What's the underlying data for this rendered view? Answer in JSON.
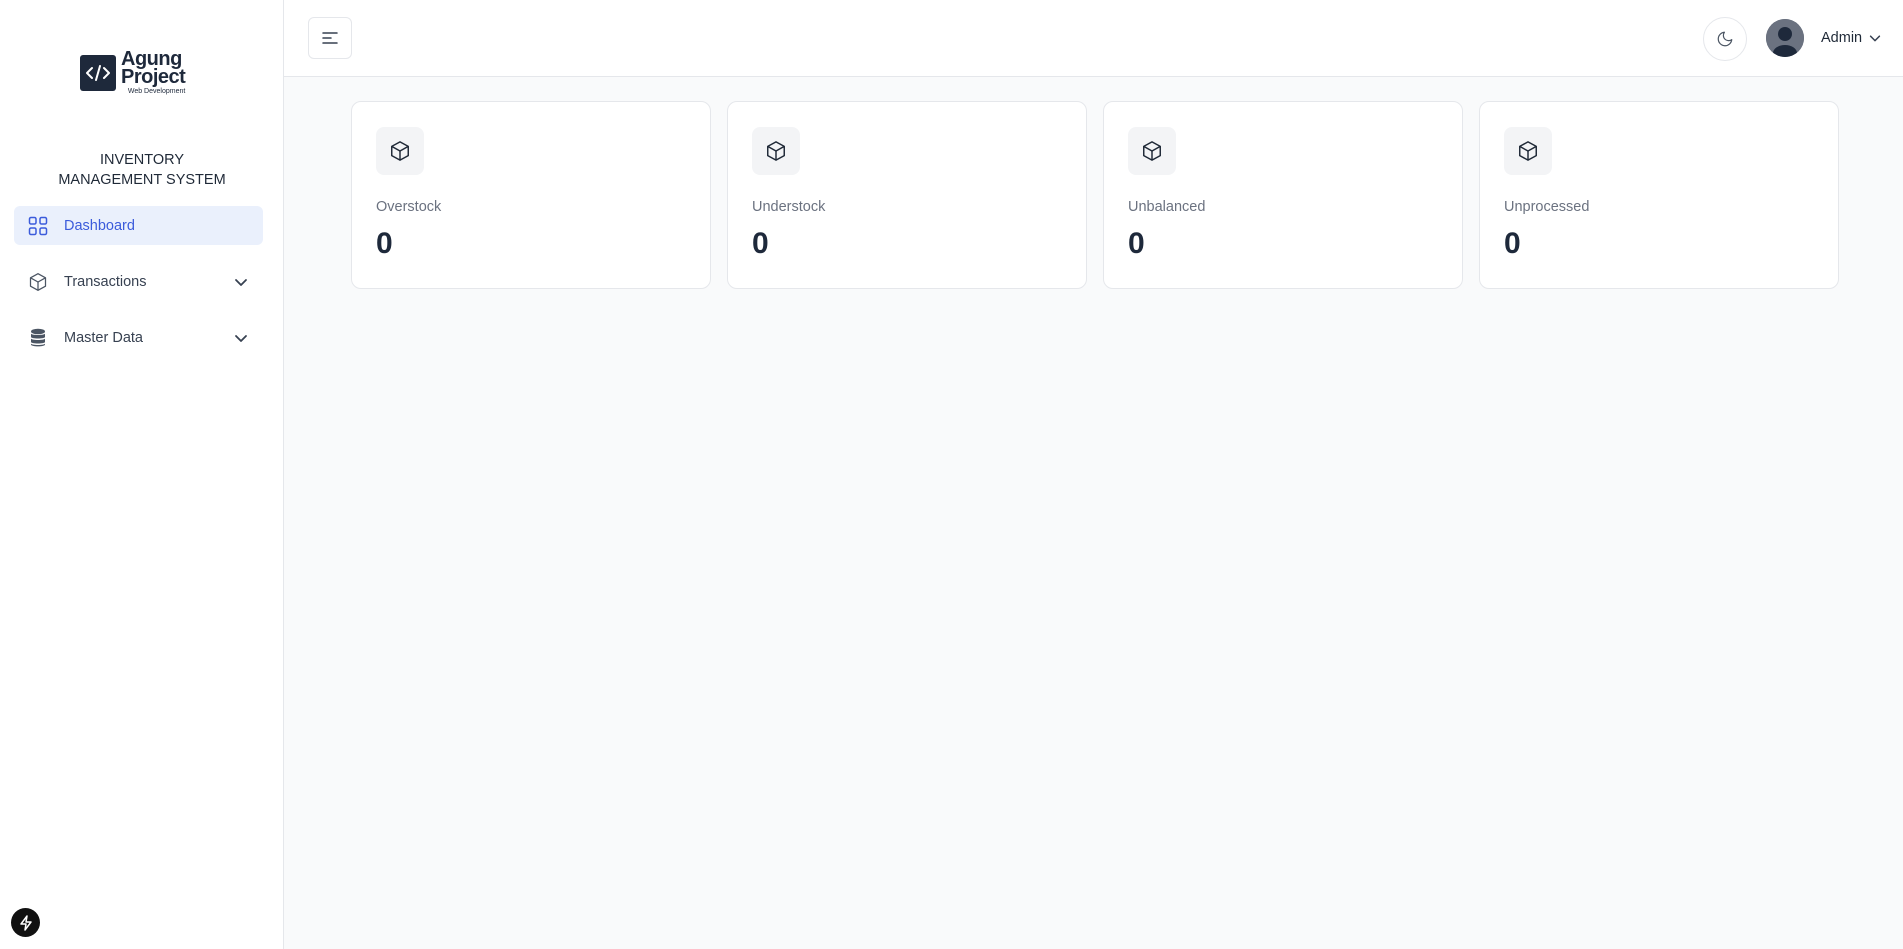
{
  "brand": {
    "logo_title_line1": "Agung",
    "logo_title_line2": "Project",
    "logo_subtitle": "Web Development",
    "app_title": "INVENTORY MANAGEMENT SYSTEM"
  },
  "sidebar": {
    "items": [
      {
        "label": "Dashboard",
        "icon": "grid-icon",
        "active": true
      },
      {
        "label": "Transactions",
        "icon": "box-icon",
        "expandable": true
      },
      {
        "label": "Master Data",
        "icon": "database-icon",
        "expandable": true
      }
    ]
  },
  "header": {
    "user_name": "Admin"
  },
  "cards": [
    {
      "label": "Overstock",
      "value": "0",
      "icon": "box-icon"
    },
    {
      "label": "Understock",
      "value": "0",
      "icon": "box-icon"
    },
    {
      "label": "Unbalanced",
      "value": "0",
      "icon": "box-icon"
    },
    {
      "label": "Unprocessed",
      "value": "0",
      "icon": "box-icon"
    }
  ],
  "colors": {
    "accent": "#3b5bdb",
    "active_bg": "#eaf0fc",
    "brand_dark": "#1e293b"
  }
}
